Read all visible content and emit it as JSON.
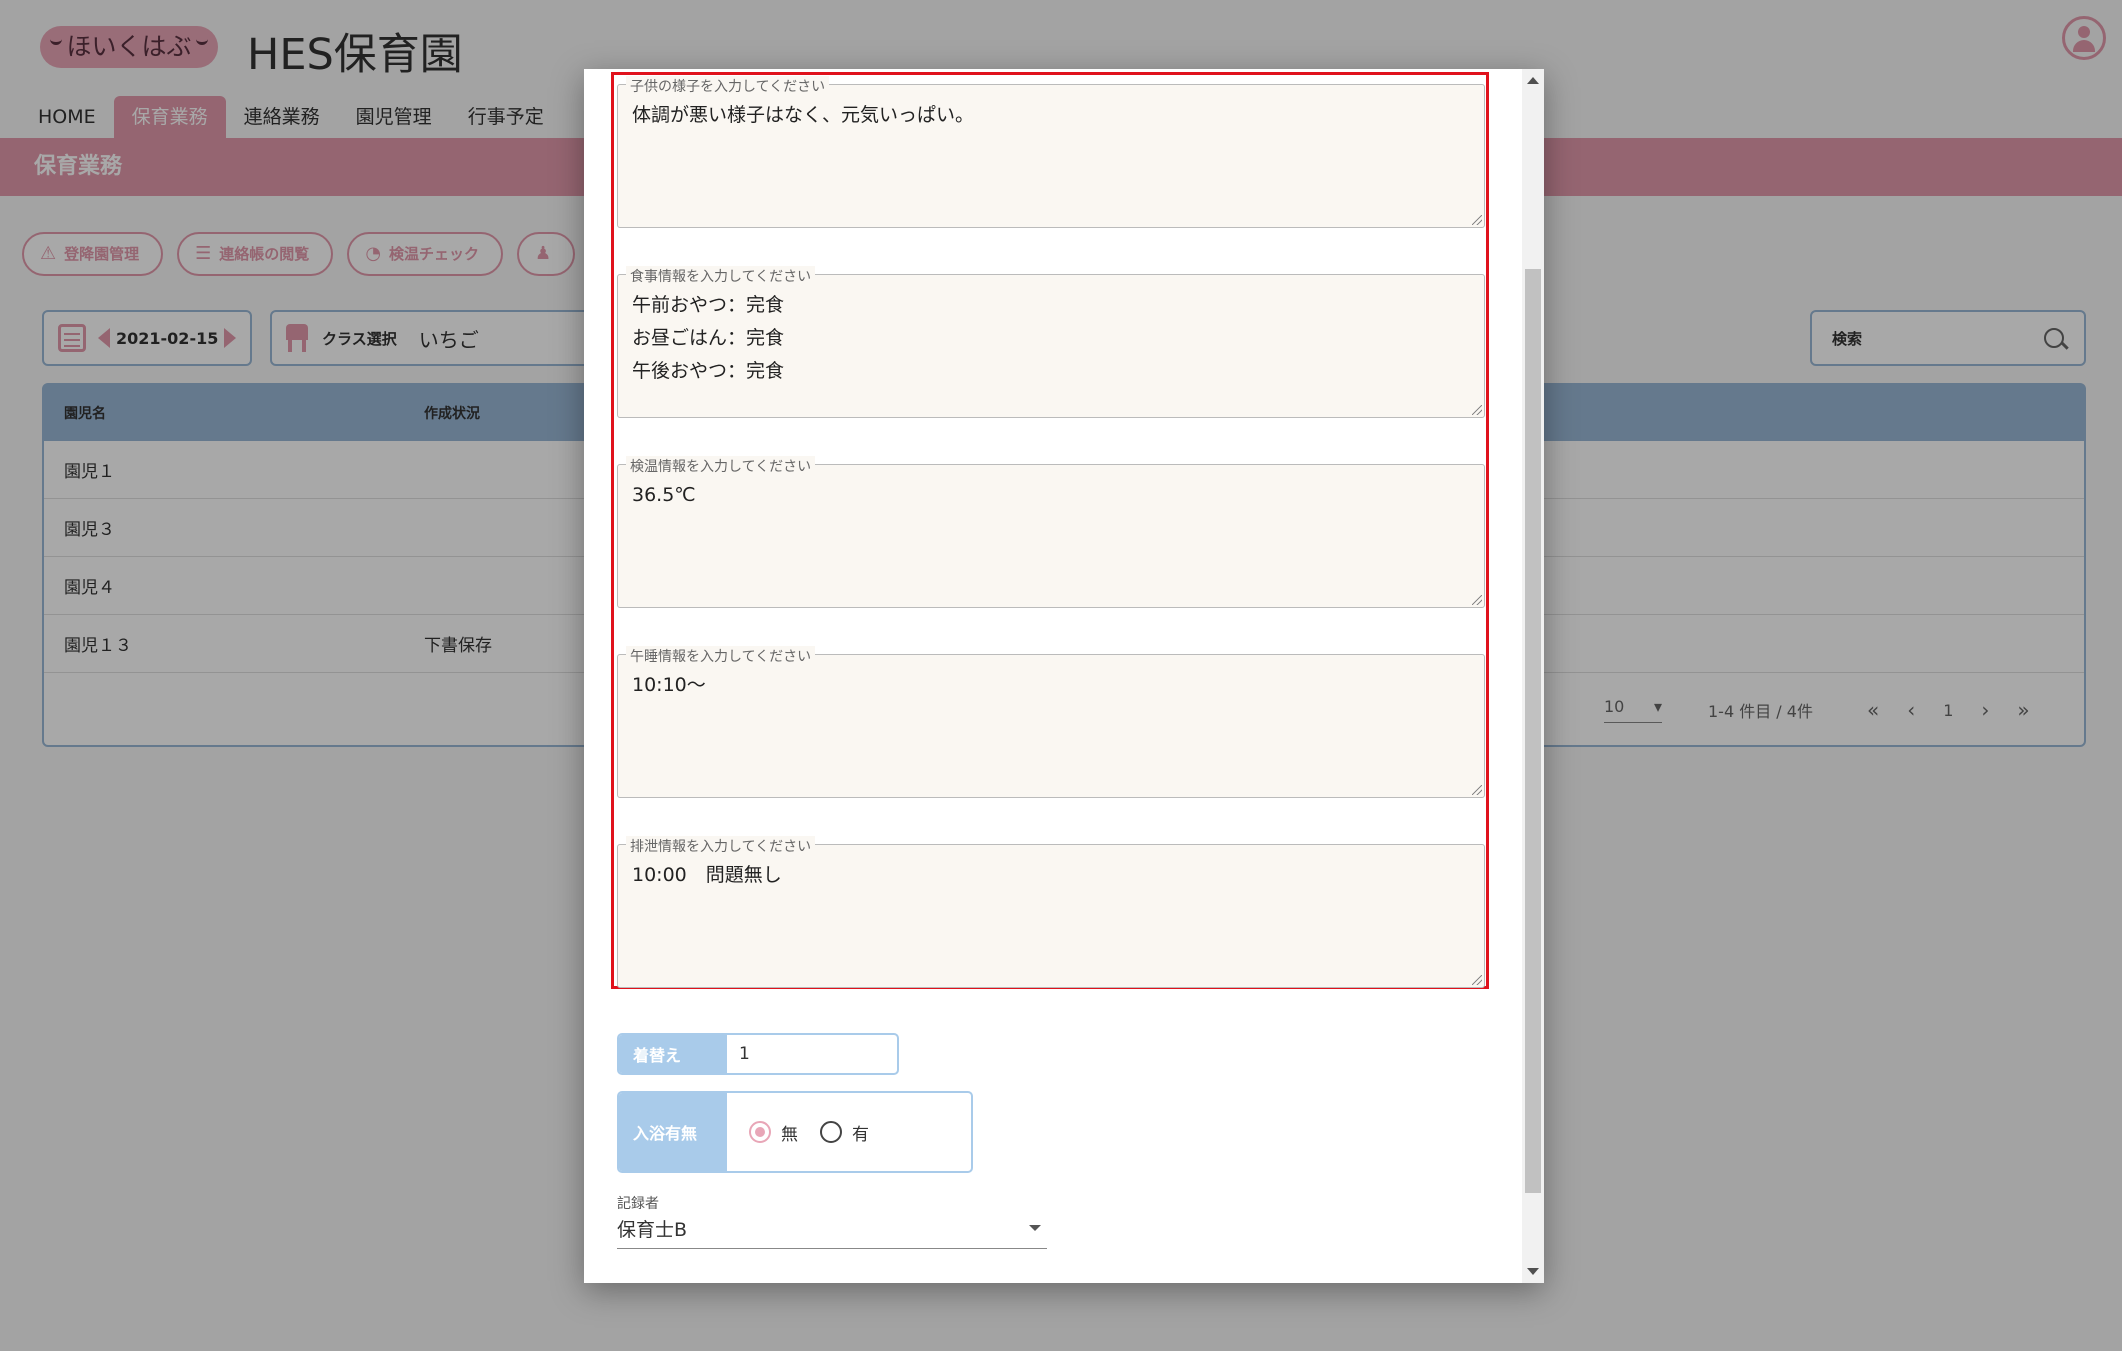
{
  "app": {
    "logo": "ほいくはぶ",
    "title": "HES保育園"
  },
  "nav": [
    "HOME",
    "保育業務",
    "連絡業務",
    "園児管理",
    "行事予定"
  ],
  "section_title": "保育業務",
  "toolbar": [
    "登降園管理",
    "連絡帳の閲覧",
    "検温チェック"
  ],
  "filters": {
    "date": "2021-02-15",
    "class_label": "クラス選択",
    "class_value": "いちご",
    "search_label": "検索"
  },
  "table": {
    "headers": [
      "園児名",
      "作成状況"
    ],
    "rows": [
      {
        "name": "園児１",
        "status": ""
      },
      {
        "name": "園児３",
        "status": ""
      },
      {
        "name": "園児４",
        "status": ""
      },
      {
        "name": "園児１３",
        "status": "下書保存"
      }
    ]
  },
  "pager": {
    "rows_per_page": "10",
    "range": "1-4 件目 / 4件",
    "page": "1"
  },
  "modal": {
    "fields": [
      {
        "label": "子供の様子を入力してください",
        "value": "体調が悪い様子はなく、元気いっぱい。"
      },
      {
        "label": "食事情報を入力してください",
        "value": "午前おやつ：完食\nお昼ごはん：完食\n午後おやつ：完食"
      },
      {
        "label": "検温情報を入力してください",
        "value": "36.5℃"
      },
      {
        "label": "午睡情報を入力してください",
        "value": "10:10～"
      },
      {
        "label": "排泄情報を入力してください",
        "value": "10:00　問題無し"
      }
    ],
    "kigae": {
      "label": "着替え",
      "value": "1"
    },
    "bath": {
      "label": "入浴有無",
      "options": [
        "無",
        "有"
      ],
      "selected": "無"
    },
    "recorder": {
      "label": "記録者",
      "value": "保育士B"
    }
  },
  "colors": {
    "accent": "#e39aac",
    "table_header": "#9ab8d6",
    "highlight": "#e0121c"
  }
}
